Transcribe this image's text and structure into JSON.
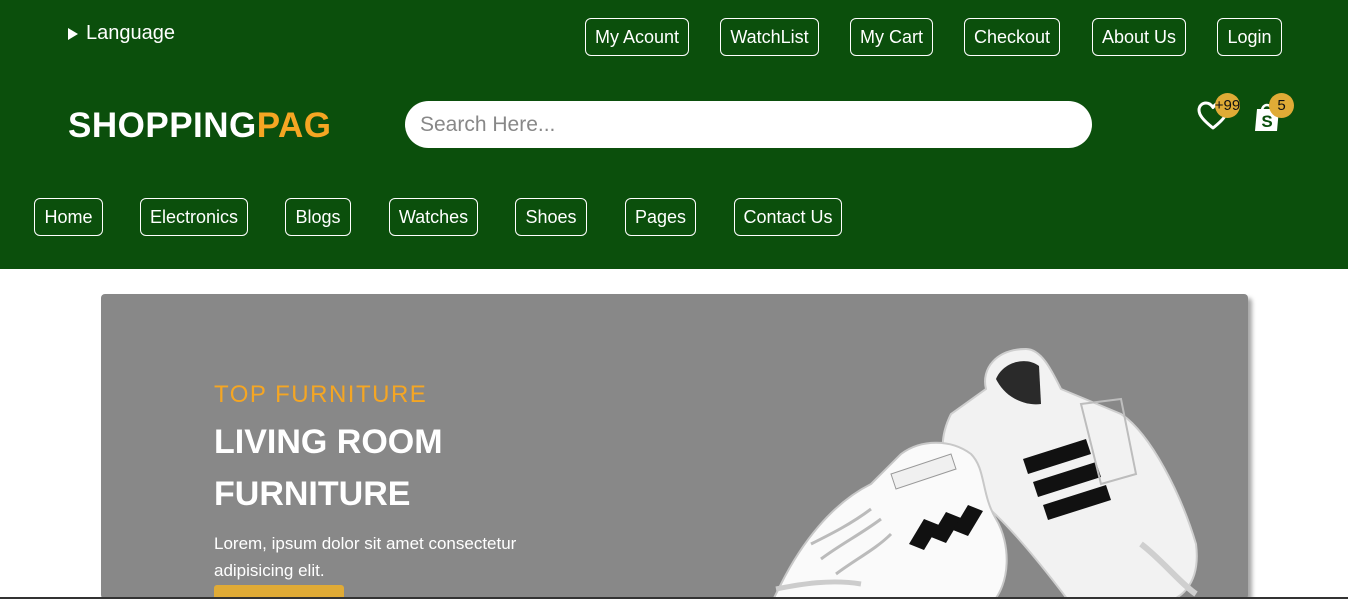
{
  "header": {
    "language_label": "Language",
    "top_links": [
      "My Acount",
      "WatchList",
      "My Cart",
      "Checkout",
      "About Us",
      "Login"
    ],
    "logo_primary": "SHOPPING",
    "logo_accent": "PAG",
    "search_placeholder": "Search Here...",
    "wishlist_count": "+99",
    "cart_count": "5",
    "nav_links": [
      "Home",
      "Electronics",
      "Blogs",
      "Watches",
      "Shoes",
      "Pages",
      "Contact Us"
    ],
    "icons": {
      "language": "triangle-right-icon",
      "wishlist": "heart-icon",
      "cart": "shopping-bag-icon"
    }
  },
  "banner": {
    "subtitle": "TOP FURNITURE",
    "title": "LIVING ROOM FURNITURE",
    "description": "Lorem, ipsum dolor sit amet consectetur adipisicing elit.",
    "image": "sneakers-image"
  },
  "colors": {
    "header_bg": "#0b4f0c",
    "accent": "#f5a623",
    "badge": "#e0ab36",
    "banner_bg": "#888888"
  }
}
